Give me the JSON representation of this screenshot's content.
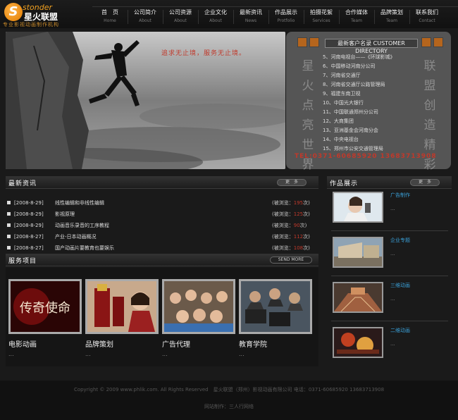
{
  "logo": {
    "s": "S",
    "en": "stonder",
    "cn": "星火联盟",
    "tagline": "专业影视动画制作机构"
  },
  "nav": [
    {
      "cn": "首　页",
      "en": "Home"
    },
    {
      "cn": "公司简介",
      "en": "About"
    },
    {
      "cn": "公司资源",
      "en": "About"
    },
    {
      "cn": "企业文化",
      "en": "About"
    },
    {
      "cn": "最新资讯",
      "en": "News"
    },
    {
      "cn": "作品展示",
      "en": "Protfolio"
    },
    {
      "cn": "拍摄花絮",
      "en": "Services"
    },
    {
      "cn": "合作媒体",
      "en": "Team"
    },
    {
      "cn": "品牌策划",
      "en": "Team"
    },
    {
      "cn": "联系我们",
      "en": "Contact"
    }
  ],
  "banner": {
    "slogan": "追求无止境，服务无止境。"
  },
  "directory": {
    "title": "最新客户名录 CUSTOMER DIRECTORY",
    "left_chars": [
      "星",
      "火",
      "点",
      "亮",
      "世",
      "界"
    ],
    "right_chars": [
      "联",
      "盟",
      "创",
      "造",
      "精",
      "彩"
    ],
    "items": [
      "5、河南电视台——《环球影城》",
      "6、中国移动河南分公司",
      "7、河南省交通厅",
      "8、河南省交通厅公路管理局",
      "9、福建东南卫视",
      "10、中国光大银行",
      "11、中国联通郑州分公司",
      "12、大商集团",
      "13、亚洲基金会河南分会",
      "14、中央电视台",
      "15、郑州市公安交通管理局"
    ],
    "tel": "TEL:0371-60685920 13683713908"
  },
  "news": {
    "title": "最新资讯",
    "more": "更　多",
    "views_prefix": "(被浏览：",
    "views_suffix": "次)",
    "items": [
      {
        "date": "[2008-8-29]",
        "title": "线性编辑和非线性编辑",
        "views": "195"
      },
      {
        "date": "[2008-8-29]",
        "title": "影视原理",
        "views": "125"
      },
      {
        "date": "[2008-8-29]",
        "title": "动画音乐录音的工序教程",
        "views": "90"
      },
      {
        "date": "[2008-8-27]",
        "title": "产业-日本动画概况",
        "views": "112"
      },
      {
        "date": "[2008-8-27]",
        "title": "国产动画片要教育也要娱乐",
        "views": "108"
      }
    ]
  },
  "services": {
    "title": "服务项目",
    "more": "SEND MORE",
    "items": [
      {
        "label": "电影动画",
        "dots": "...",
        "art": "传奇使命"
      },
      {
        "label": "品牌策划",
        "dots": "..."
      },
      {
        "label": "广告代理",
        "dots": "..."
      },
      {
        "label": "教育学院",
        "dots": "..."
      }
    ]
  },
  "works": {
    "title": "作品展示",
    "more": "更　多",
    "items": [
      {
        "title": "广告制作",
        "dots": "..."
      },
      {
        "title": "企业专题",
        "dots": "..."
      },
      {
        "title": "三维动画",
        "dots": "..."
      },
      {
        "title": "二维动画",
        "dots": "..."
      }
    ]
  },
  "footer": {
    "copyright": "Copyright © 2009 www.phlik.com. All Rights Reserved　星火联盟（郑州）影视动画有限公司 电话：0371-60685920 13683713908",
    "made": "网站制作：三人行网络"
  },
  "colors": {
    "accent_red": "#c0392b",
    "link_blue": "#3aa0d8",
    "logo_orange": "#e07b00"
  }
}
